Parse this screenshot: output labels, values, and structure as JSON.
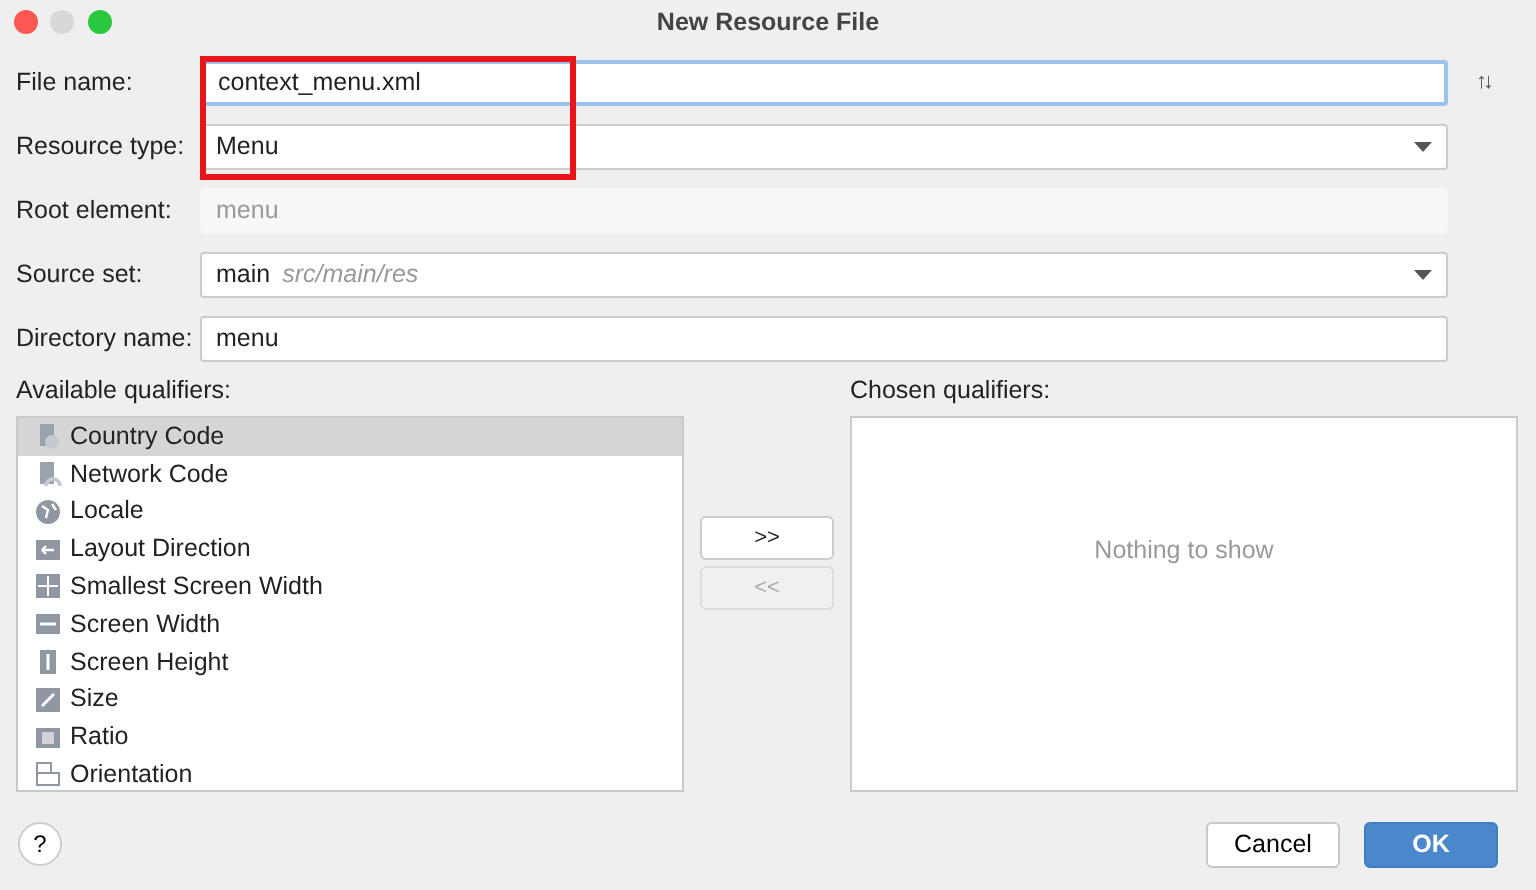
{
  "window": {
    "title": "New Resource File"
  },
  "fields": [
    {
      "label": "File name:",
      "kind": "text",
      "value": "context_menu.xml",
      "focused": true,
      "highlighted": true,
      "side_icon": "↑↓"
    },
    {
      "label": "Resource type:",
      "kind": "dropdown",
      "value": "Menu",
      "focused": false,
      "highlighted": true
    },
    {
      "label": "Root element:",
      "kind": "text",
      "value": "menu",
      "disabled": true,
      "focused": false,
      "highlighted": false
    },
    {
      "label": "Source set:",
      "kind": "dropdown",
      "value": "main",
      "hint": "src/main/res",
      "focused": false,
      "highlighted": false
    },
    {
      "label": "Directory name:",
      "kind": "text",
      "value": "menu",
      "focused": false,
      "highlighted": false
    }
  ],
  "available_qualifiers": {
    "label": "Available qualifiers:",
    "items": [
      {
        "label": "Country Code",
        "kind": "country",
        "selected": true
      },
      {
        "label": "Network Code",
        "kind": "network",
        "selected": false
      },
      {
        "label": "Locale",
        "kind": "locale",
        "selected": false
      },
      {
        "label": "Layout Direction",
        "kind": "direction",
        "selected": false
      },
      {
        "label": "Smallest Screen Width",
        "kind": "smallest",
        "selected": false
      },
      {
        "label": "Screen Width",
        "kind": "width",
        "selected": false
      },
      {
        "label": "Screen Height",
        "kind": "height",
        "selected": false
      },
      {
        "label": "Size",
        "kind": "size",
        "selected": false
      },
      {
        "label": "Ratio",
        "kind": "ratio",
        "selected": false
      },
      {
        "label": "Orientation",
        "kind": "orientation",
        "selected": false
      }
    ]
  },
  "transfer_buttons": [
    {
      "label": ">>",
      "disabled": false
    },
    {
      "label": "<<",
      "disabled": true
    }
  ],
  "chosen_qualifiers": {
    "label": "Chosen qualifiers:",
    "empty_text": "Nothing to show"
  },
  "help_button": "?",
  "buttons": [
    {
      "label": "Cancel",
      "default": false
    },
    {
      "label": "OK",
      "default": true
    }
  ]
}
